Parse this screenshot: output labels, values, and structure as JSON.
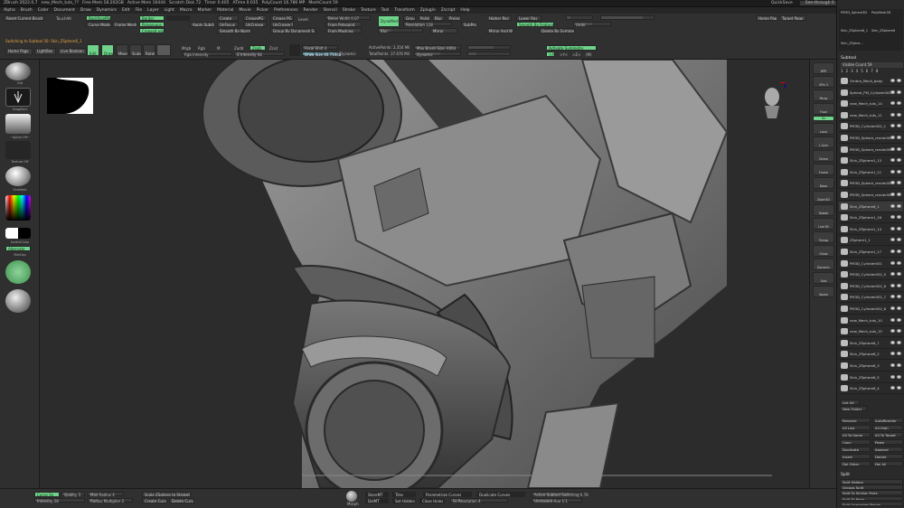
{
  "titlebar": {
    "app": "ZBrush 2022.0.7",
    "document": "new_Mech_tuts_??",
    "free_mem": "Free Mem 18.202GB",
    "active_mem": "Active Mem 16444",
    "scratch_disk": "Scratch Disk 72",
    "timer": "Timer 0.405",
    "atime": "ATime 0.035",
    "polycount": "PolyCount 16.786 MP",
    "meshcount": "MeshCount 59",
    "quicksave": "QuickSave",
    "seethrough": "See-through 0",
    "menus_btn": "Menus",
    "default_zscript": "DefaultZScript"
  },
  "menubar": [
    "Alpha",
    "Brush",
    "Color",
    "Document",
    "Draw",
    "Dynamics",
    "Edit",
    "File",
    "Layer",
    "Light",
    "Macro",
    "Marker",
    "Material",
    "Movie",
    "Picker",
    "Preferences",
    "Render",
    "Stencil",
    "Stroke",
    "Texture",
    "Tool",
    "Transform",
    "Zplugin",
    "Zscript",
    "Help"
  ],
  "palette": {
    "reset_brush": "Reset Current Brush",
    "touch_tool": "TouchAlt",
    "backface": "BackfaceMask",
    "curve_mode": "Curve Mode",
    "frame_mesh": "Frame Mesh",
    "border": "Border",
    "polygroups": "Polygroups",
    "creased": "Creased edges",
    "create": "Create",
    "unfocus": "UnFocus",
    "apply_subdiv": "Apply Subdiv",
    "crease_pg": "CreasePG",
    "uncrease": "UnCrease",
    "uncrease_all": "UnCreaseAll",
    "crease_pg2": "Crease PG",
    "uncrease_pg": "UnCrease PG",
    "smooth_by_normals": "Smooth By Normals",
    "group_by_dynamesh": "Group By Dynamesh Sub",
    "bevel_width": "Bevel Width 0.07",
    "from_polypaint": "From Polypaint",
    "from_masking": "From Masking",
    "dynamesh": "DynaMesh",
    "groups": "Groups",
    "polish": "Polish",
    "project": "Project",
    "resolution": "Resolution 128",
    "subproject": "SubProjects",
    "blur": "Blur",
    "mirror": "Mirror",
    "mirror_and_weld": "Mirror And Weld",
    "higher_res": "Higher Res",
    "lower_res": "Lower Res",
    "smooth_by_features": "Smooth By Features",
    "delete_by_symmetry": "Delete By Symmetry",
    "undo_history": "Undo",
    "switching": "Switching to Subtool 56: Skin_ZSphere6_1",
    "home_page": "Home Page",
    "lightbox": "LightBox",
    "live_boolean": "Live Boolean",
    "edit": "Edit",
    "draw": "Draw",
    "move": "Move",
    "scale": "Scale",
    "rotate": "Rotate",
    "mrgb": "Mrgb",
    "rgb": "Rgb",
    "m": "M",
    "zadd": "Zadd",
    "zsub": "Zsub",
    "zcut": "Zcut",
    "rgb_intensity": "Rgb Intensity",
    "z_intensity": "Z Intensity 48",
    "focal_shift": "Focal Shift 0",
    "draw_size": "Draw Size 40.71448",
    "dynamic": "Dynamic",
    "active_points": "ActivePoints: 2,354 Mil",
    "total_points": "TotalPoints: 37.676 Mil",
    "max_brush": "Max Brush Size: 4404",
    "dynamic2": "Dynamic",
    "activate_symmetry": "Activate Symmetry",
    "x": ">X<",
    "y": ">Y<",
    "z": ">Z<",
    "m2": "(M)",
    "r": "(R)",
    "home_page2": "Home Page",
    "target_page": "Target Page"
  },
  "leftshelf": {
    "brush_label": "Orb",
    "stroke_label": "DragRect",
    "alpha_label": "~Alpha Off~",
    "texture_label": "Texture Off",
    "material_label": "Gradient",
    "switch_color": "SwitchColor",
    "alternate": "Alternate",
    "matcap": "MatCap"
  },
  "viewport": {
    "gizmo_labels": [
      "X",
      "Y",
      "Z"
    ]
  },
  "rightstrip": {
    "items": [
      "BPR",
      "SPix 3",
      "Persp",
      "Floor",
      "Local",
      "L.Sym",
      "Gizmo",
      "Frame",
      "Move",
      "Zoom3D",
      "Rotate",
      "Line Fill",
      "Transp",
      "Ghost",
      "Dynamic",
      "Solo",
      "Xpose"
    ],
    "floor_toggle": "On"
  },
  "rightpanel": {
    "tool_header": [
      "PM3D_Sphere3D",
      "PolyMesh3D",
      "Skin_ZSphere6_1",
      "Skin_ZSphere6",
      "Skin_ZSpher..."
    ],
    "subtool_title": "Subtool",
    "visible_count": "Visible Count 59",
    "numbers": [
      "1",
      "2",
      "3",
      "4",
      "5",
      "6",
      "7",
      "8"
    ],
    "subtools": [
      "Ombra_Mech_body",
      "Sphere_PM_Cylinder002",
      "new_Mech_tuts_14",
      "new_Mech_tuts_11",
      "PM3D_Cylinder002_1",
      "PM3D_Sphere_render002_8",
      "PM3D_Sphere_render002_3",
      "Skin_ZSphere1_13",
      "Skin_ZSphere1_11",
      "PM3D_Sphere_render002_2",
      "PM3D_Sphere_render002_12",
      "Skin_ZSphere6_1",
      "Skin_ZSphere1_16",
      "Skin_ZSphere1_14",
      "ZSphere1_1",
      "Skin_ZSphere1_17",
      "PM3D_Cylinder001",
      "PM3D_Cylinder002_5",
      "PM3D_Cylinder002_6",
      "PM3D_Cylinder002_7",
      "PM3D_Cylinder002_8",
      "new_Mech_tuts_10",
      "new_Mech_tuts_15",
      "Skin_ZSphere6_7",
      "Skin_ZSphere6_2",
      "Skin_ZSphere6_3",
      "Skin_ZSphere6_5",
      "Skin_ZSphere6_4"
    ],
    "list_all": "List All",
    "new_folder": "New Folder",
    "actions": [
      "Rename",
      "AutoReorder",
      "All Low",
      "All High",
      "All To Home",
      "All To Target",
      "Copy",
      "Paste",
      "Duplicate",
      "Append",
      "Insert",
      "Delete",
      "Del Other",
      "Del All"
    ],
    "split": "Split",
    "split_actions": [
      "Split Hidden",
      "Groups Split",
      "Split To Similar Parts",
      "Split To Parts",
      "Split Unmasked Points"
    ]
  },
  "bottombar": {
    "curvesn": "Curve Sn",
    "quality": "Quality 5",
    "intensity": "Intensity 28",
    "max_radius": "Max Radius 4",
    "radius_mult": "Radius Multiplier 2",
    "scale_zsphere": "Scale ZSphere to StrokeSize",
    "create_curve": "Create Curve",
    "delete_curve": "Delete Curve",
    "morph_label": "Morph",
    "storemt": "StoreMT",
    "delmt": "DelMT",
    "set_hidden": "Set Hidden",
    "close_holes": "Close Holes",
    "parametrize": "Parametrize Curves",
    "tiles": "Tiles",
    "duplicate_curves": "Duplicate Curves",
    "active_subtool": "Active Subtool Switching 0.78",
    "spherical_hsl": "Unshaded Hue 1:1",
    "sphere_detect": "Ss Resolution 4"
  }
}
